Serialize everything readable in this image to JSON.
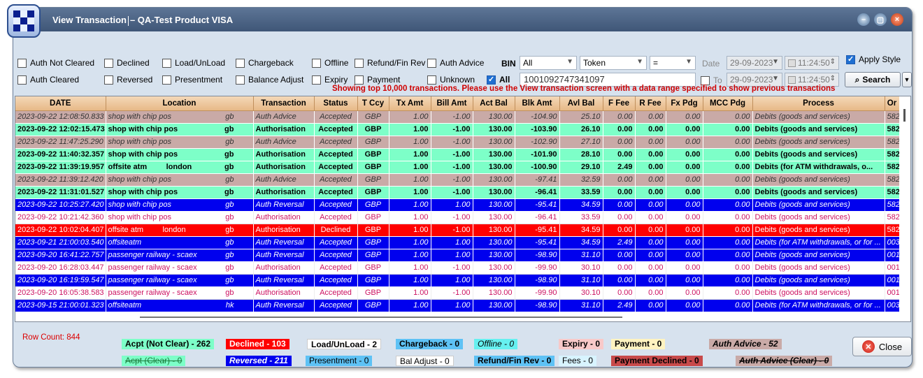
{
  "window": {
    "title": "View Transaction",
    "subtitle": "– QA-Test Product VISA"
  },
  "filters": {
    "row1": [
      "Auth Not Cleared",
      "Declined",
      "Load/UnLoad",
      "Chargeback",
      "Offline",
      "Refund/Fin Rev",
      "Auth Advice"
    ],
    "row2": [
      "Auth Cleared",
      "Reversed",
      "Presentment",
      "Balance Adjust",
      "Expiry",
      "Payment",
      "Unknown"
    ],
    "all_label": "All",
    "all_checked": true,
    "bin_label": "BIN",
    "bin_value": "All",
    "token_value": "Token",
    "operator_value": "=",
    "search_value": "1001092747341097",
    "date_label": "Date",
    "date_from": "29-09-2023",
    "time_from": "11:24:50",
    "to_label": "To",
    "date_to": "29-09-2023",
    "time_to": "11:24:50",
    "apply_style_label": "Apply Style",
    "apply_style_checked": true,
    "search_button": "Search"
  },
  "notice": "Showing top 10,000 transactions. Please use the View transaction screen with a data range specified to show previous transactions",
  "table": {
    "columns": [
      "DATE",
      "Location",
      "Transaction",
      "Status",
      "T Ccy",
      "Tx Amt",
      "Bill Amt",
      "Act Bal",
      "Blk Amt",
      "Avl Bal",
      "F Fee",
      "R Fee",
      "Fx Pdg",
      "MCC Pdg",
      "Process",
      "Or"
    ],
    "rows": [
      {
        "style": "advice",
        "date": "2023-09-22 12:08:50.833",
        "loc": "shop with chip pos",
        "country": "gb",
        "tx": "Auth Advice",
        "status": "Accepted",
        "ccy": "GBP",
        "txamt": "1.00",
        "bill": "-1.00",
        "act": "130.00",
        "blk": "-104.90",
        "avl": "25.10",
        "ffee": "0.00",
        "rfee": "0.00",
        "fx": "0.00",
        "mcc": "0.00",
        "proc": "Debits (goods and services)",
        "or": "582"
      },
      {
        "style": "auth",
        "date": "2023-09-22 12:02:15.473",
        "loc": "shop with chip pos",
        "country": "gb",
        "tx": "Authorisation",
        "status": "Accepted",
        "ccy": "GBP",
        "txamt": "1.00",
        "bill": "-1.00",
        "act": "130.00",
        "blk": "-103.90",
        "avl": "26.10",
        "ffee": "0.00",
        "rfee": "0.00",
        "fx": "0.00",
        "mcc": "0.00",
        "proc": "Debits (goods and services)",
        "or": "582"
      },
      {
        "style": "advice",
        "date": "2023-09-22 11:47:25.290",
        "loc": "shop with chip pos",
        "country": "gb",
        "tx": "Auth Advice",
        "status": "Accepted",
        "ccy": "GBP",
        "txamt": "1.00",
        "bill": "-1.00",
        "act": "130.00",
        "blk": "-102.90",
        "avl": "27.10",
        "ffee": "0.00",
        "rfee": "0.00",
        "fx": "0.00",
        "mcc": "0.00",
        "proc": "Debits (goods and services)",
        "or": "582"
      },
      {
        "style": "auth",
        "date": "2023-09-22 11:40:32.357",
        "loc": "shop with chip pos",
        "country": "gb",
        "tx": "Authorisation",
        "status": "Accepted",
        "ccy": "GBP",
        "txamt": "1.00",
        "bill": "-1.00",
        "act": "130.00",
        "blk": "-101.90",
        "avl": "28.10",
        "ffee": "0.00",
        "rfee": "0.00",
        "fx": "0.00",
        "mcc": "0.00",
        "proc": "Debits (goods and services)",
        "or": "582"
      },
      {
        "style": "auth",
        "date": "2023-09-22 11:39:19.957",
        "loc": "offsite atm         london",
        "country": "gb",
        "tx": "Authorisation",
        "status": "Accepted",
        "ccy": "GBP",
        "txamt": "1.00",
        "bill": "-1.00",
        "act": "130.00",
        "blk": "-100.90",
        "avl": "29.10",
        "ffee": "2.49",
        "rfee": "0.00",
        "fx": "0.00",
        "mcc": "0.00",
        "proc": "Debits (for ATM withdrawals, o...",
        "or": "582"
      },
      {
        "style": "advice",
        "date": "2023-09-22 11:39:12.420",
        "loc": "shop with chip pos",
        "country": "gb",
        "tx": "Auth Advice",
        "status": "Accepted",
        "ccy": "GBP",
        "txamt": "1.00",
        "bill": "-1.00",
        "act": "130.00",
        "blk": "-97.41",
        "avl": "32.59",
        "ffee": "0.00",
        "rfee": "0.00",
        "fx": "0.00",
        "mcc": "0.00",
        "proc": "Debits (goods and services)",
        "or": "582"
      },
      {
        "style": "auth",
        "date": "2023-09-22 11:31:01.527",
        "loc": "shop with chip pos",
        "country": "gb",
        "tx": "Authorisation",
        "status": "Accepted",
        "ccy": "GBP",
        "txamt": "1.00",
        "bill": "-1.00",
        "act": "130.00",
        "blk": "-96.41",
        "avl": "33.59",
        "ffee": "0.00",
        "rfee": "0.00",
        "fx": "0.00",
        "mcc": "0.00",
        "proc": "Debits (goods and services)",
        "or": "582"
      },
      {
        "style": "rev",
        "date": "2023-09-22 10:25:27.420",
        "loc": "shop with chip pos",
        "country": "gb",
        "tx": "Auth Reversal",
        "status": "Accepted",
        "ccy": "GBP",
        "txamt": "1.00",
        "bill": "1.00",
        "act": "130.00",
        "blk": "-95.41",
        "avl": "34.59",
        "ffee": "0.00",
        "rfee": "0.00",
        "fx": "0.00",
        "mcc": "0.00",
        "proc": "Debits (goods and services)",
        "or": "582"
      },
      {
        "style": "pres",
        "date": "2023-09-22 10:21:42.360",
        "loc": "shop with chip pos",
        "country": "gb",
        "tx": "Authorisation",
        "status": "Accepted",
        "ccy": "GBP",
        "txamt": "1.00",
        "bill": "-1.00",
        "act": "130.00",
        "blk": "-96.41",
        "avl": "33.59",
        "ffee": "0.00",
        "rfee": "0.00",
        "fx": "0.00",
        "mcc": "0.00",
        "proc": "Debits (goods and services)",
        "or": "582"
      },
      {
        "style": "decl",
        "date": "2023-09-22 10:02:04.407",
        "loc": "offsite atm         london",
        "country": "gb",
        "tx": "Authorisation",
        "status": "Declined",
        "ccy": "GBP",
        "txamt": "1.00",
        "bill": "-1.00",
        "act": "130.00",
        "blk": "-95.41",
        "avl": "34.59",
        "ffee": "0.00",
        "rfee": "0.00",
        "fx": "0.00",
        "mcc": "0.00",
        "proc": "Debits (goods and services)",
        "or": "582"
      },
      {
        "style": "rev",
        "date": "2023-09-21 21:00:03.540",
        "loc": "offsiteatm",
        "country": "gb",
        "tx": "Auth Reversal",
        "status": "Accepted",
        "ccy": "GBP",
        "txamt": "1.00",
        "bill": "1.00",
        "act": "130.00",
        "blk": "-95.41",
        "avl": "34.59",
        "ffee": "2.49",
        "rfee": "0.00",
        "fx": "0.00",
        "mcc": "0.00",
        "proc": "Debits (for ATM withdrawals, or for ...",
        "or": "003"
      },
      {
        "style": "rev",
        "date": "2023-09-20 16:41:22.757",
        "loc": "passenger railway - scaex",
        "country": "gb",
        "tx": "Auth Reversal",
        "status": "Accepted",
        "ccy": "GBP",
        "txamt": "1.00",
        "bill": "1.00",
        "act": "130.00",
        "blk": "-98.90",
        "avl": "31.10",
        "ffee": "0.00",
        "rfee": "0.00",
        "fx": "0.00",
        "mcc": "0.00",
        "proc": "Debits (goods and services)",
        "or": "001"
      },
      {
        "style": "pres",
        "date": "2023-09-20 16:28:03.447",
        "loc": "passenger railway - scaex",
        "country": "gb",
        "tx": "Authorisation",
        "status": "Accepted",
        "ccy": "GBP",
        "txamt": "1.00",
        "bill": "-1.00",
        "act": "130.00",
        "blk": "-99.90",
        "avl": "30.10",
        "ffee": "0.00",
        "rfee": "0.00",
        "fx": "0.00",
        "mcc": "0.00",
        "proc": "Debits (goods and services)",
        "or": "001"
      },
      {
        "style": "rev",
        "date": "2023-09-20 16:19:59.547",
        "loc": "passenger railway - scaex",
        "country": "gb",
        "tx": "Auth Reversal",
        "status": "Accepted",
        "ccy": "GBP",
        "txamt": "1.00",
        "bill": "1.00",
        "act": "130.00",
        "blk": "-98.90",
        "avl": "31.10",
        "ffee": "0.00",
        "rfee": "0.00",
        "fx": "0.00",
        "mcc": "0.00",
        "proc": "Debits (goods and services)",
        "or": "001"
      },
      {
        "style": "pres",
        "date": "2023-09-20 16:05:38.583",
        "loc": "passenger railway - scaex",
        "country": "gb",
        "tx": "Authorisation",
        "status": "Accepted",
        "ccy": "GBP",
        "txamt": "1.00",
        "bill": "-1.00",
        "act": "130.00",
        "blk": "-99.90",
        "avl": "30.10",
        "ffee": "0.00",
        "rfee": "0.00",
        "fx": "0.00",
        "mcc": "0.00",
        "proc": "Debits (goods and services)",
        "or": "001"
      },
      {
        "style": "rev",
        "date": "2023-09-15 21:00:01.323",
        "loc": "offsiteatm",
        "country": "hk",
        "tx": "Auth Reversal",
        "status": "Accepted",
        "ccy": "GBP",
        "txamt": "1.00",
        "bill": "1.00",
        "act": "130.00",
        "blk": "-98.90",
        "avl": "31.10",
        "ffee": "2.49",
        "rfee": "0.00",
        "fx": "0.00",
        "mcc": "0.00",
        "proc": "Debits (for ATM withdrawals, or for ...",
        "or": "003"
      }
    ]
  },
  "footer": {
    "row_count": "Row Count: 844",
    "badges": [
      {
        "text": "Acpt (Not Clear) - 262",
        "bg": "#7dffc8",
        "fg": "#000",
        "bold": true
      },
      {
        "text": "Declined - 103",
        "bg": "#ff0000",
        "fg": "#ffffff",
        "bold": true
      },
      {
        "text": "Load/UnLoad - 2",
        "bg": "#ffffff",
        "fg": "#000",
        "bold": true
      },
      {
        "text": "Chargeback - 0",
        "bg": "#5ec2f5",
        "fg": "#000",
        "bold": true
      },
      {
        "text": "Offline - 0",
        "bg": "#66f0f0",
        "fg": "#000",
        "italic": true
      },
      {
        "text": "Expiry - 0",
        "bg": "#f8c9c9",
        "fg": "#000",
        "bold": true
      },
      {
        "text": "Payment - 0",
        "bg": "#fff3c0",
        "fg": "#000",
        "bold": true
      },
      {
        "text": "Auth Advice - 52",
        "bg": "#c9aaa7",
        "fg": "#000",
        "bold": true,
        "italic": true
      },
      {
        "text": "Acpt (Clear) - 0",
        "bg": "#7dffc8",
        "fg": "#1a7a3a",
        "strike": true
      },
      {
        "text": "Reversed - 211",
        "bg": "#0000ee",
        "fg": "#ffffff",
        "bold": true,
        "italic": true
      },
      {
        "text": "Presentment - 0",
        "bg": "#5ec2f5",
        "fg": "#000"
      },
      {
        "text": "Bal Adjust - 0",
        "bg": "#ffffff",
        "fg": "#000"
      },
      {
        "text": "Refund/Fin Rev - 0",
        "bg": "#5ec2f5",
        "fg": "#000",
        "bold": true
      },
      {
        "text": "Fees - 0",
        "bg": "#d8f4ff",
        "fg": "#000"
      },
      {
        "text": "Payment Declined - 0",
        "bg": "#c84a4a",
        "fg": "#000",
        "bold": true
      },
      {
        "text": "Auth Advice (Clear) - 0",
        "bg": "#c9aaa7",
        "fg": "#000",
        "bold": true,
        "italic": true,
        "strike": true
      }
    ],
    "close_label": "Close"
  }
}
